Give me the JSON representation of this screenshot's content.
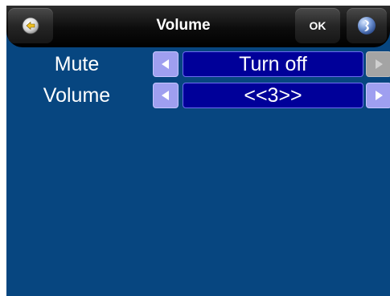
{
  "header": {
    "title": "Volume",
    "ok_label": "OK",
    "back_icon": "back-arrow-icon",
    "logo_icon": "app-logo-icon"
  },
  "settings": [
    {
      "label": "Mute",
      "value": "Turn off",
      "prev_enabled": true,
      "next_enabled": false
    },
    {
      "label": "Volume",
      "value": "<<3>>",
      "prev_enabled": true,
      "next_enabled": true
    }
  ],
  "colors": {
    "background": "#074680",
    "value_box": "#000099",
    "arrow_enabled": "#9f9ff0",
    "arrow_disabled": "#a4a4a4"
  }
}
